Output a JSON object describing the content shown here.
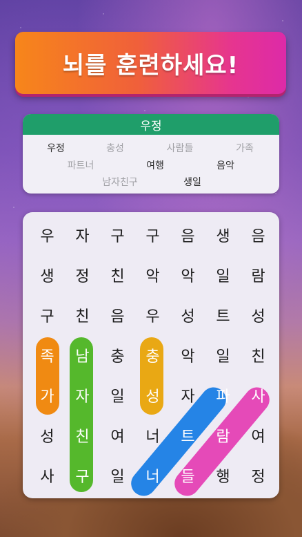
{
  "banner": {
    "title": "뇌를 훈련하세요!"
  },
  "category": {
    "title": "우정"
  },
  "words": [
    {
      "text": "우정",
      "found": false
    },
    {
      "text": "충성",
      "found": true
    },
    {
      "text": "사람들",
      "found": true
    },
    {
      "text": "가족",
      "found": true
    },
    {
      "text": "파트너",
      "found": true
    },
    {
      "text": "여행",
      "found": false
    },
    {
      "text": "음악",
      "found": false
    },
    {
      "text": "남자친구",
      "found": true
    },
    {
      "text": "생일",
      "found": false
    }
  ],
  "grid": [
    [
      "우",
      "자",
      "구",
      "구",
      "음",
      "생",
      "음"
    ],
    [
      "생",
      "정",
      "친",
      "악",
      "악",
      "일",
      "람"
    ],
    [
      "구",
      "친",
      "음",
      "우",
      "성",
      "트",
      "성"
    ],
    [
      "족",
      "남",
      "충",
      "충",
      "악",
      "일",
      "친"
    ],
    [
      "가",
      "자",
      "일",
      "성",
      "자",
      "파",
      "사"
    ],
    [
      "성",
      "친",
      "여",
      "너",
      "트",
      "람",
      "여"
    ],
    [
      "사",
      "구",
      "일",
      "너",
      "들",
      "행",
      "정"
    ]
  ],
  "colors": {
    "banner_start": "#f7861a",
    "banner_end": "#dd2aa8",
    "header": "#1f9e6a",
    "orange": "#f08a12",
    "green": "#55b82c",
    "yellow": "#e9a814",
    "blue": "#2584e6",
    "pink": "#e54ab8"
  }
}
